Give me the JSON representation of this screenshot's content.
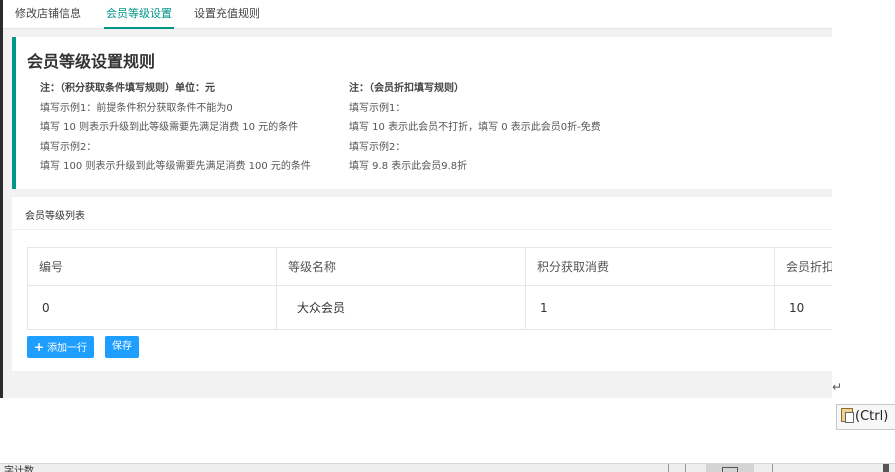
{
  "tabs": [
    {
      "label": "修改店铺信息",
      "active": false
    },
    {
      "label": "会员等级设置",
      "active": true
    },
    {
      "label": "设置充值规则",
      "active": false
    }
  ],
  "rules": {
    "title": "会员等级设置规则",
    "left": [
      "注：（积分获取条件填写规则）单位：元",
      "填写示例1：前提条件积分获取条件不能为0",
      "填写 10 则表示升级到此等级需要先满足消费 10 元的条件",
      "填写示例2：",
      "填写 100 则表示升级到此等级需要先满足消费 100 元的条件"
    ],
    "right": [
      "注：（会员折扣填写规则）",
      "填写示例1：",
      "填写 10 表示此会员不打折，填写 0 表示此会员0折-免费",
      "填写示例2：",
      "填写 9.8 表示此会员9.8折"
    ]
  },
  "list": {
    "title": "会员等级列表",
    "columns": [
      "编号",
      "等级名称",
      "积分获取消费",
      "会员折扣"
    ],
    "rows": [
      {
        "id": "0",
        "name": "大众会员",
        "points": "1",
        "discount": "10"
      }
    ],
    "add_label": "添加一行",
    "save_label": "保存"
  },
  "doc": {
    "return_mark": "↵",
    "paste_label": "(Ctrl)"
  },
  "statusbar": {
    "text": "字计数"
  },
  "colors": {
    "accent": "#009688",
    "button": "#1e9fff"
  }
}
